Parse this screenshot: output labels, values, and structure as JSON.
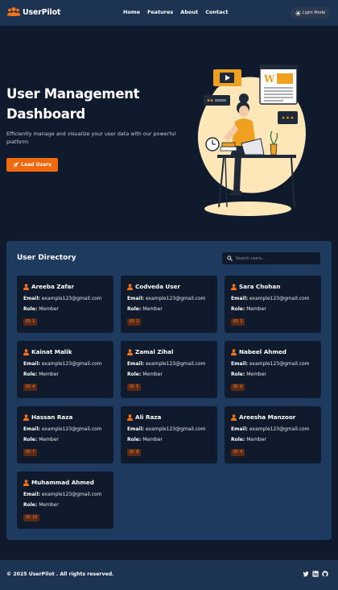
{
  "brand": {
    "name": "UserPilot",
    "icon": "users-icon",
    "accent": "#f97316"
  },
  "nav": {
    "links": [
      "Home",
      "Features",
      "About",
      "Contact"
    ],
    "mode_label": "Light Mode",
    "mode_icon": "sun-icon"
  },
  "hero": {
    "title": "User Management Dashboard",
    "subtitle": "Efficiently manage and visualize your user data with our powerful platform",
    "button_label": "Load Users",
    "button_icon": "rocket-icon",
    "illustration": "woman-working-at-laptop-illustration"
  },
  "directory": {
    "title": "User Directory",
    "search_placeholder": "Search users...",
    "email_label": "Email:",
    "role_label": "Role:",
    "users": [
      {
        "name": "Areeba Zafar",
        "email": "example123@gmail.com",
        "role": "Member",
        "id": "ID: 1"
      },
      {
        "name": "Codveda User",
        "email": "example123@gmail.com",
        "role": "Member",
        "id": "ID: 2"
      },
      {
        "name": "Sara Chohan",
        "email": "example123@gmail.com",
        "role": "Member",
        "id": "ID: 3"
      },
      {
        "name": "Kainat Malik",
        "email": "example123@gmail.com",
        "role": "Member",
        "id": "ID: 4"
      },
      {
        "name": "Zamal Zihal",
        "email": "example123@gmail.com",
        "role": "Member",
        "id": "ID: 5"
      },
      {
        "name": "Nabeel Ahmed",
        "email": "example123@gmail.com",
        "role": "Member",
        "id": "ID: 6"
      },
      {
        "name": "Hassan Raza",
        "email": "example123@gmail.com",
        "role": "Member",
        "id": "ID: 7"
      },
      {
        "name": "Ali Raza",
        "email": "example123@gmail.com",
        "role": "Member",
        "id": "ID: 8"
      },
      {
        "name": "Areesha Manzoor",
        "email": "example123@gmail.com",
        "role": "Member",
        "id": "ID: 9"
      },
      {
        "name": "Muhammad Ahmed",
        "email": "example123@gmail.com",
        "role": "Member",
        "id": "ID: 10"
      }
    ]
  },
  "footer": {
    "copyright": "© 2025 UserPilot . All rights reserved.",
    "social_icons": [
      "twitter-icon",
      "linkedin-icon",
      "github-icon"
    ]
  },
  "colors": {
    "page_bg": "#0f1b2d",
    "nav_bg": "#1d3352",
    "panel_bg": "#1e3a5f",
    "card_bg": "#0f1b2d",
    "accent": "#f0690f"
  }
}
